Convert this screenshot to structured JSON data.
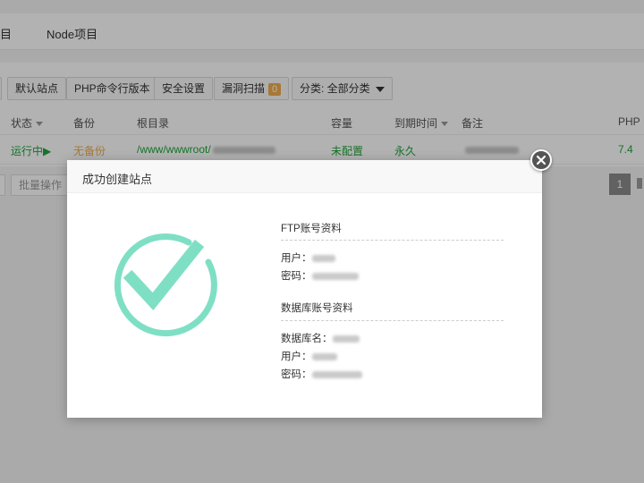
{
  "topnav": {
    "tabs": [
      {
        "label": "目"
      },
      {
        "label": "Node项目"
      }
    ]
  },
  "toolbar": {
    "default_site": "默认站点",
    "php_cli": "PHP命令行版本",
    "security": "安全设置",
    "vuln_scan": "漏洞扫描",
    "vuln_count": "0",
    "category": "分类: 全部分类"
  },
  "table": {
    "headers": {
      "status": "状态",
      "backup": "备份",
      "root": "根目录",
      "capacity": "容量",
      "expire": "到期时间",
      "note": "备注",
      "php": "PHP"
    },
    "row": {
      "status": "运行中▶",
      "backup": "无备份",
      "root_prefix": "/www/wwwroot/",
      "capacity": "未配置",
      "expire": "永久",
      "php": "7.4"
    }
  },
  "footer": {
    "batch_label": "批量操作",
    "page": "1"
  },
  "modal": {
    "title": "成功创建站点",
    "ftp": {
      "title": "FTP账号资料",
      "user_label": "用户：",
      "pass_label": "密码："
    },
    "db": {
      "title": "数据库账号资料",
      "name_label": "数据库名：",
      "user_label": "用户：",
      "pass_label": "密码："
    }
  },
  "colors": {
    "success_teal": "#7fdfc4",
    "running_green": "#20a53a",
    "no_backup_orange": "#f0ad4e"
  },
  "icons": {
    "success": "check-circle-icon",
    "close": "close-icon",
    "dropdown": "chevron-down-icon"
  }
}
